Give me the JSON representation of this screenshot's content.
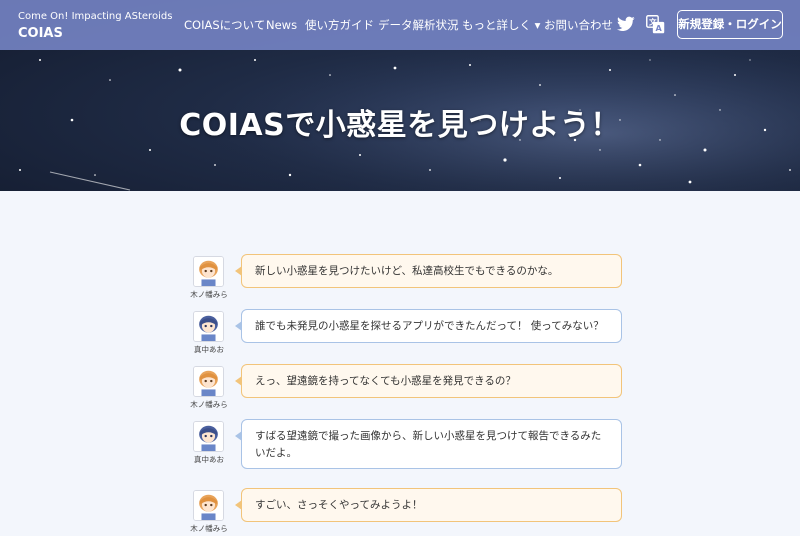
{
  "brand": {
    "tagline": "Come On! Impacting ASteroids",
    "name": "COIAS"
  },
  "nav": {
    "items": [
      "COIASについて",
      "News",
      "使い方ガイド",
      "データ解析状況",
      "もっと詳しく ▾",
      "お問い合わせ"
    ],
    "login_label": "新規登録・ログイン"
  },
  "icons": {
    "twitter": "twitter-bird-icon",
    "translate": "translate-icon"
  },
  "hero": {
    "title": "COIASで小惑星を見つけよう！"
  },
  "colors": {
    "navbar": "#7886c8",
    "orange_border": "#f2c47a",
    "blue_border": "#a9c3e6",
    "page_bg": "#f3f6fc"
  },
  "chat": [
    {
      "speaker": "木ノ幡みら",
      "text": "新しい小惑星を見つけたいけど、私達高校生でもできるのかな。"
    },
    {
      "speaker": "真中あお",
      "text": "誰でも未発見の小惑星を探せるアプリができたんだって！ 使ってみない？"
    },
    {
      "speaker": "木ノ幡みら",
      "text": "えっ、望遠鏡を持ってなくても小惑星を発見できるの？"
    },
    {
      "speaker": "真中あお",
      "text": "すばる望遠鏡で撮った画像から、新しい小惑星を見つけて報告できるみたいだよ。"
    },
    {
      "speaker": "木ノ幡みら",
      "text": "すごい、さっそくやってみようよ！"
    }
  ]
}
